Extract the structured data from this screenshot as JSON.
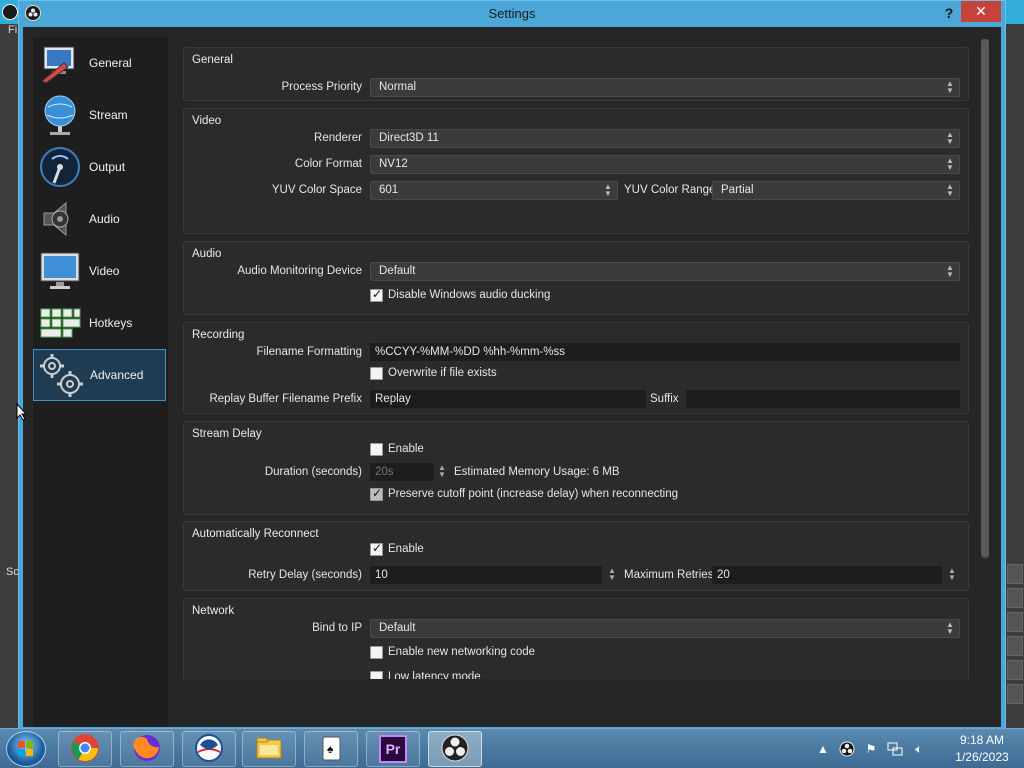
{
  "background_app": {
    "menu_fragment": "Fi",
    "scene_fragment": "Sc"
  },
  "dialog": {
    "title": "Settings",
    "help_label": "?",
    "close_label": "✕"
  },
  "sidebar": {
    "items": [
      {
        "label": "General",
        "icon": "general-icon"
      },
      {
        "label": "Stream",
        "icon": "stream-icon"
      },
      {
        "label": "Output",
        "icon": "output-icon"
      },
      {
        "label": "Audio",
        "icon": "audio-icon"
      },
      {
        "label": "Video",
        "icon": "video-icon"
      },
      {
        "label": "Hotkeys",
        "icon": "hotkeys-icon"
      },
      {
        "label": "Advanced",
        "icon": "advanced-icon",
        "active": true
      }
    ]
  },
  "general": {
    "title": "General",
    "process_priority_label": "Process Priority",
    "process_priority_value": "Normal"
  },
  "video": {
    "title": "Video",
    "renderer_label": "Renderer",
    "renderer_value": "Direct3D 11",
    "color_format_label": "Color Format",
    "color_format_value": "NV12",
    "yuv_color_space_label": "YUV Color Space",
    "yuv_color_space_value": "601",
    "yuv_color_range_label": "YUV Color Range",
    "yuv_color_range_value": "Partial"
  },
  "audio": {
    "title": "Audio",
    "monitoring_device_label": "Audio Monitoring Device",
    "monitoring_device_value": "Default",
    "disable_ducking_label": "Disable Windows audio ducking",
    "disable_ducking_checked": true
  },
  "recording": {
    "title": "Recording",
    "filename_formatting_label": "Filename Formatting",
    "filename_formatting_value": "%CCYY-%MM-%DD %hh-%mm-%ss",
    "overwrite_label": "Overwrite if file exists",
    "overwrite_checked": false,
    "replay_prefix_label": "Replay Buffer Filename Prefix",
    "replay_prefix_value": "Replay",
    "suffix_label": "Suffix",
    "suffix_value": ""
  },
  "stream_delay": {
    "title": "Stream Delay",
    "enable_label": "Enable",
    "enable_checked": false,
    "duration_label": "Duration (seconds)",
    "duration_value": "20s",
    "memory_usage": "Estimated Memory Usage: 6 MB",
    "preserve_label": "Preserve cutoff point (increase delay) when reconnecting",
    "preserve_checked": true
  },
  "auto_reconnect": {
    "title": "Automatically Reconnect",
    "enable_label": "Enable",
    "enable_checked": true,
    "retry_delay_label": "Retry Delay (seconds)",
    "retry_delay_value": "10",
    "max_retries_label": "Maximum Retries",
    "max_retries_value": "20"
  },
  "network": {
    "title": "Network",
    "bind_ip_label": "Bind to IP",
    "bind_ip_value": "Default",
    "new_networking_label": "Enable new networking code",
    "new_networking_checked": false,
    "low_latency_label": "Low latency mode"
  },
  "taskbar": {
    "apps": [
      "chrome-icon",
      "firefox-icon",
      "obama-logo-icon",
      "file-explorer-icon",
      "solitaire-icon",
      "premiere-icon",
      "obs-icon"
    ],
    "active_app": "obs-icon",
    "premiere_label": "Pr",
    "time": "9:18 AM",
    "date": "1/26/2023"
  },
  "colors": {
    "accent": "#4aa7d8",
    "close": "#c7423a",
    "sidebar_active": "#1f3c52",
    "panel": "#2b2b2b"
  }
}
